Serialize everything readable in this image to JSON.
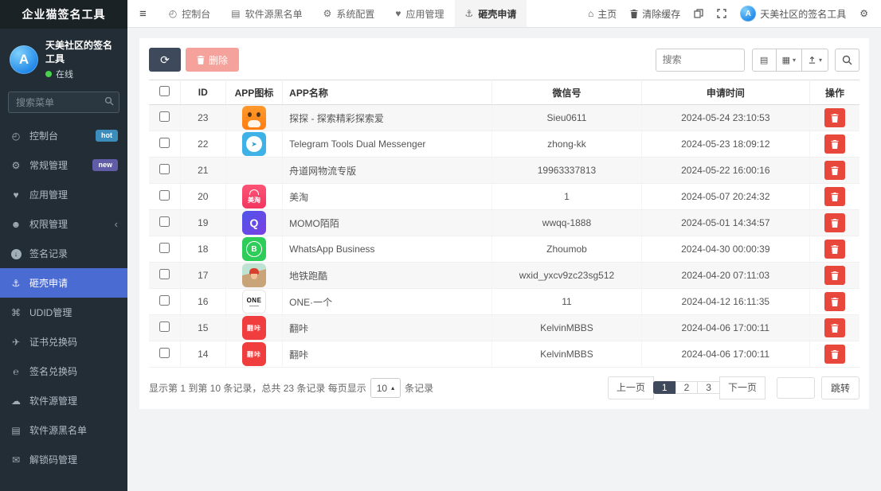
{
  "app": {
    "title": "企业猫签名工具"
  },
  "colors": {
    "accent": "#4a6bd2",
    "danger": "#e8473b",
    "dark_btn": "#3e4a5c",
    "hot_badge": "#3c8dbc",
    "new_badge": "#605ca8",
    "online": "#46d24a"
  },
  "sidebar": {
    "user": {
      "name": "天美社区的签名工具",
      "status": "在线"
    },
    "search_placeholder": "搜索菜单",
    "items": [
      {
        "id": "dashboard",
        "label": "控制台",
        "icon": "gauge-icon",
        "badge": "hot",
        "badge_color": "#3c8dbc",
        "active": false
      },
      {
        "id": "general-mgmt",
        "label": "常规管理",
        "icon": "cogs-icon",
        "badge": "new",
        "badge_color": "#605ca8",
        "active": false
      },
      {
        "id": "app-mgmt",
        "label": "应用管理",
        "icon": "heart-icon",
        "active": false
      },
      {
        "id": "permission-mgmt",
        "label": "权限管理",
        "icon": "users-icon",
        "chevron": "‹",
        "active": false
      },
      {
        "id": "sign-records",
        "label": "签名记录",
        "icon": "history-icon",
        "active": false
      },
      {
        "id": "dump-request",
        "label": "砸壳申请",
        "icon": "anchor-icon",
        "active": true
      },
      {
        "id": "udid-mgmt",
        "label": "UDID管理",
        "icon": "apple-icon",
        "active": false
      },
      {
        "id": "cert-redeem",
        "label": "证书兑换码",
        "icon": "paper-plane-icon",
        "active": false
      },
      {
        "id": "sign-redeem",
        "label": "签名兑换码",
        "icon": "e-icon",
        "active": false
      },
      {
        "id": "source-mgmt",
        "label": "软件源管理",
        "icon": "cloud-icon",
        "active": false
      },
      {
        "id": "source-blacklist",
        "label": "软件源黑名单",
        "icon": "book-icon",
        "active": false
      },
      {
        "id": "unlock-mgmt",
        "label": "解锁码管理",
        "icon": "envelope-icon",
        "active": false
      }
    ]
  },
  "topnav": {
    "tabs": [
      {
        "id": "dashboard",
        "label": "控制台",
        "icon": "gauge-icon",
        "active": false
      },
      {
        "id": "source-blacklist",
        "label": "软件源黑名单",
        "icon": "book-icon",
        "active": false
      },
      {
        "id": "system-config",
        "label": "系统配置",
        "icon": "gear-icon",
        "active": false
      },
      {
        "id": "app-mgmt",
        "label": "应用管理",
        "icon": "heart-icon",
        "active": false
      },
      {
        "id": "dump-request",
        "label": "砸壳申请",
        "icon": "anchor-icon",
        "active": true
      }
    ],
    "right": {
      "home_label": "主页",
      "clear_cache_label": "清除缓存",
      "user_name": "天美社区的签名工具"
    }
  },
  "toolbar": {
    "delete_label": "删除",
    "search_placeholder": "搜索"
  },
  "table": {
    "columns": [
      "ID",
      "APP图标",
      "APP名称",
      "微信号",
      "申请时间",
      "操作"
    ],
    "rows": [
      {
        "id": "23",
        "icon": "tantan",
        "icon_text": "",
        "name": "探探 - 探索精彩探索爱",
        "wechat": "Sieu0611",
        "time": "2024-05-24 23:10:53"
      },
      {
        "id": "22",
        "icon": "telegram",
        "icon_text": "",
        "name": "Telegram Tools Dual Messenger",
        "wechat": "zhong-kk",
        "time": "2024-05-23 18:09:12"
      },
      {
        "id": "21",
        "icon": "none",
        "icon_text": "",
        "name": "舟道网物流专版",
        "wechat": "19963337813",
        "time": "2024-05-22 16:00:16"
      },
      {
        "id": "20",
        "icon": "meitao",
        "icon_text": "美淘",
        "name": "美淘",
        "wechat": "1",
        "time": "2024-05-07 20:24:32"
      },
      {
        "id": "19",
        "icon": "momo",
        "icon_text": "",
        "name": "MOMO陌陌",
        "wechat": "wwqq-1888",
        "time": "2024-05-01 14:34:57"
      },
      {
        "id": "18",
        "icon": "whatsapp",
        "icon_text": "",
        "name": "WhatsApp Business",
        "wechat": "Zhoumob",
        "time": "2024-04-30 00:00:39"
      },
      {
        "id": "17",
        "icon": "subway",
        "icon_text": "",
        "name": "地铁跑酷",
        "wechat": "wxid_yxcv9zc23sg512",
        "time": "2024-04-20 07:11:03"
      },
      {
        "id": "16",
        "icon": "one",
        "icon_text": "ONE",
        "name": "ONE·一个",
        "wechat": "11",
        "time": "2024-04-12 16:11:35"
      },
      {
        "id": "15",
        "icon": "fanka",
        "icon_text": "翻咔",
        "name": "翻咔",
        "wechat": "KelvinMBBS",
        "time": "2024-04-06 17:00:11"
      },
      {
        "id": "14",
        "icon": "fanka",
        "icon_text": "翻咔",
        "name": "翻咔",
        "wechat": "KelvinMBBS",
        "time": "2024-04-06 17:00:11"
      }
    ]
  },
  "footer": {
    "summary_prefix": "显示第 1 到第 10 条记录，总共 23 条记录 每页显示",
    "page_size": "10",
    "summary_suffix": "条记录"
  },
  "pagination": {
    "prev": "上一页",
    "pages": [
      "1",
      "2",
      "3"
    ],
    "active_page": "1",
    "next": "下一页",
    "jump_label": "跳转"
  }
}
